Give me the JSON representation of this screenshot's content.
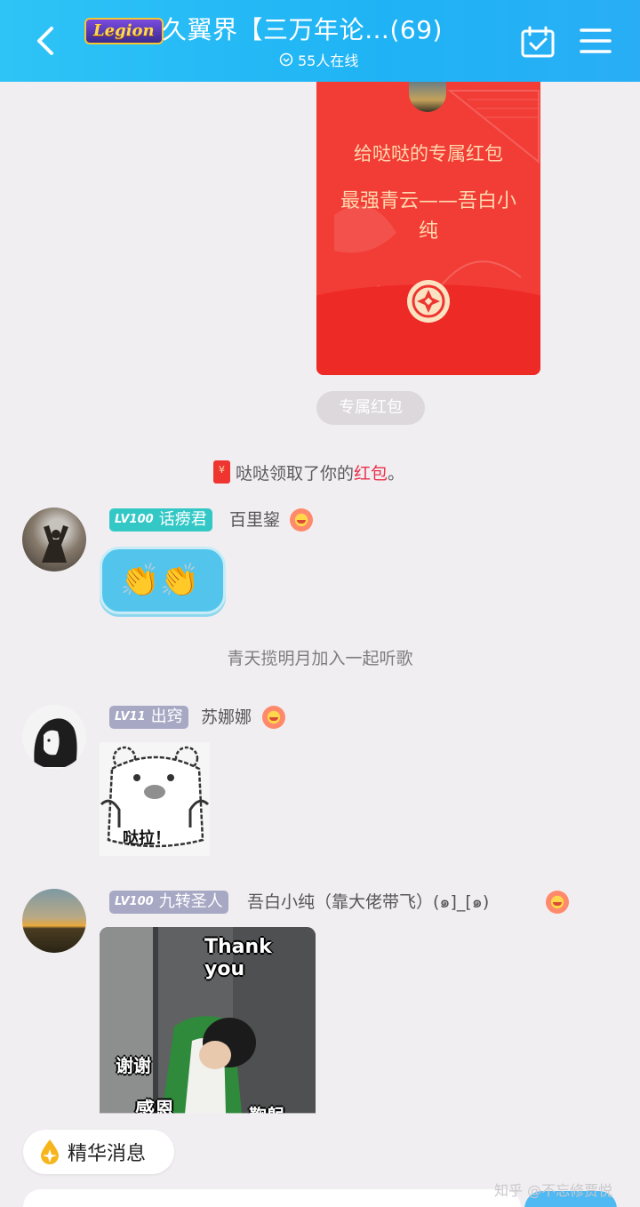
{
  "header": {
    "back_icon": "chevron-left-icon",
    "logo_text": "Legion",
    "title": "久翼界【三万年论…(69)",
    "online_icon": "chevron-circle-down-icon",
    "online_text": "55人在线",
    "calendar_icon": "calendar-check-icon",
    "menu_icon": "hamburger-menu-icon",
    "bg_color": "#22b7f5"
  },
  "red_packet": {
    "title": "给哒哒的专属红包",
    "message": "最强青云——吾白小纯",
    "type_tag": "专属红包",
    "color": "#f23c36"
  },
  "system": {
    "claim_prefix": "哒哒领取了你的",
    "claim_highlight": "红包",
    "claim_suffix": "。",
    "join_text": "青天揽明月加入一起听歌"
  },
  "messages": [
    {
      "level": "LV100",
      "title": "话痨君",
      "sender": "百里鋆",
      "content": "👏👏"
    },
    {
      "level": "LV11",
      "title": "出窍",
      "sender": "苏娜娜",
      "sticker_caption": "哒拉！"
    },
    {
      "level": "LV100",
      "title": "九转圣人",
      "sender": "吾白小纯（靠大佬带飞）(๑]_[๑)",
      "sticker_caption_en": "Thank you",
      "sticker_caption_1": "谢谢",
      "sticker_caption_2": "感恩",
      "sticker_caption_3": "鞠躬"
    }
  ],
  "footer": {
    "essence_label": "精华消息",
    "essence_icon": "gold-drop-icon",
    "watermark": "知乎 @不忘修贾悦"
  }
}
